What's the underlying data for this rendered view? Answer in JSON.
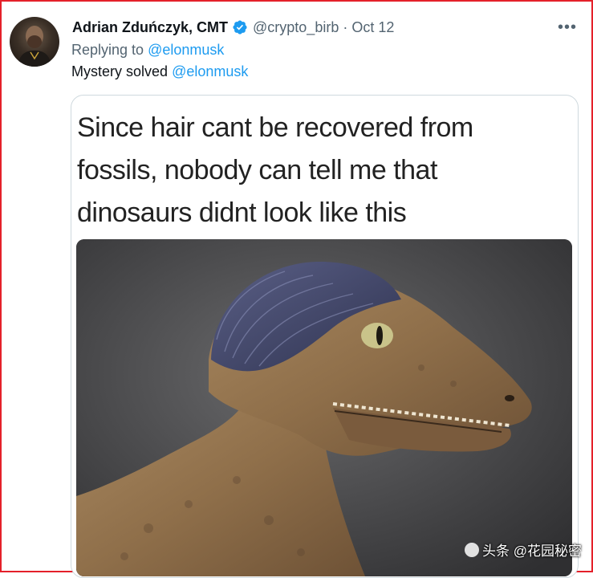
{
  "tweet": {
    "author_name": "Adrian Zduńczyk, CMT",
    "handle": "@crypto_birb",
    "separator": "·",
    "date": "Oct 12",
    "more_label": "•••",
    "replying_prefix": "Replying to",
    "replying_to": "@elonmusk",
    "text": "Mystery solved",
    "text_mention": "@elonmusk",
    "verified_color": "#1d9bf0"
  },
  "media": {
    "caption_lines": [
      "Since hair cant be recovered from",
      "fossils, nobody can tell me that",
      "dinosaurs didnt look like this"
    ]
  },
  "watermark": {
    "text": "头条 @花园秘密"
  },
  "colors": {
    "frame_border": "#e4202a",
    "mention": "#1d9bf0",
    "secondary_text": "#536471"
  }
}
